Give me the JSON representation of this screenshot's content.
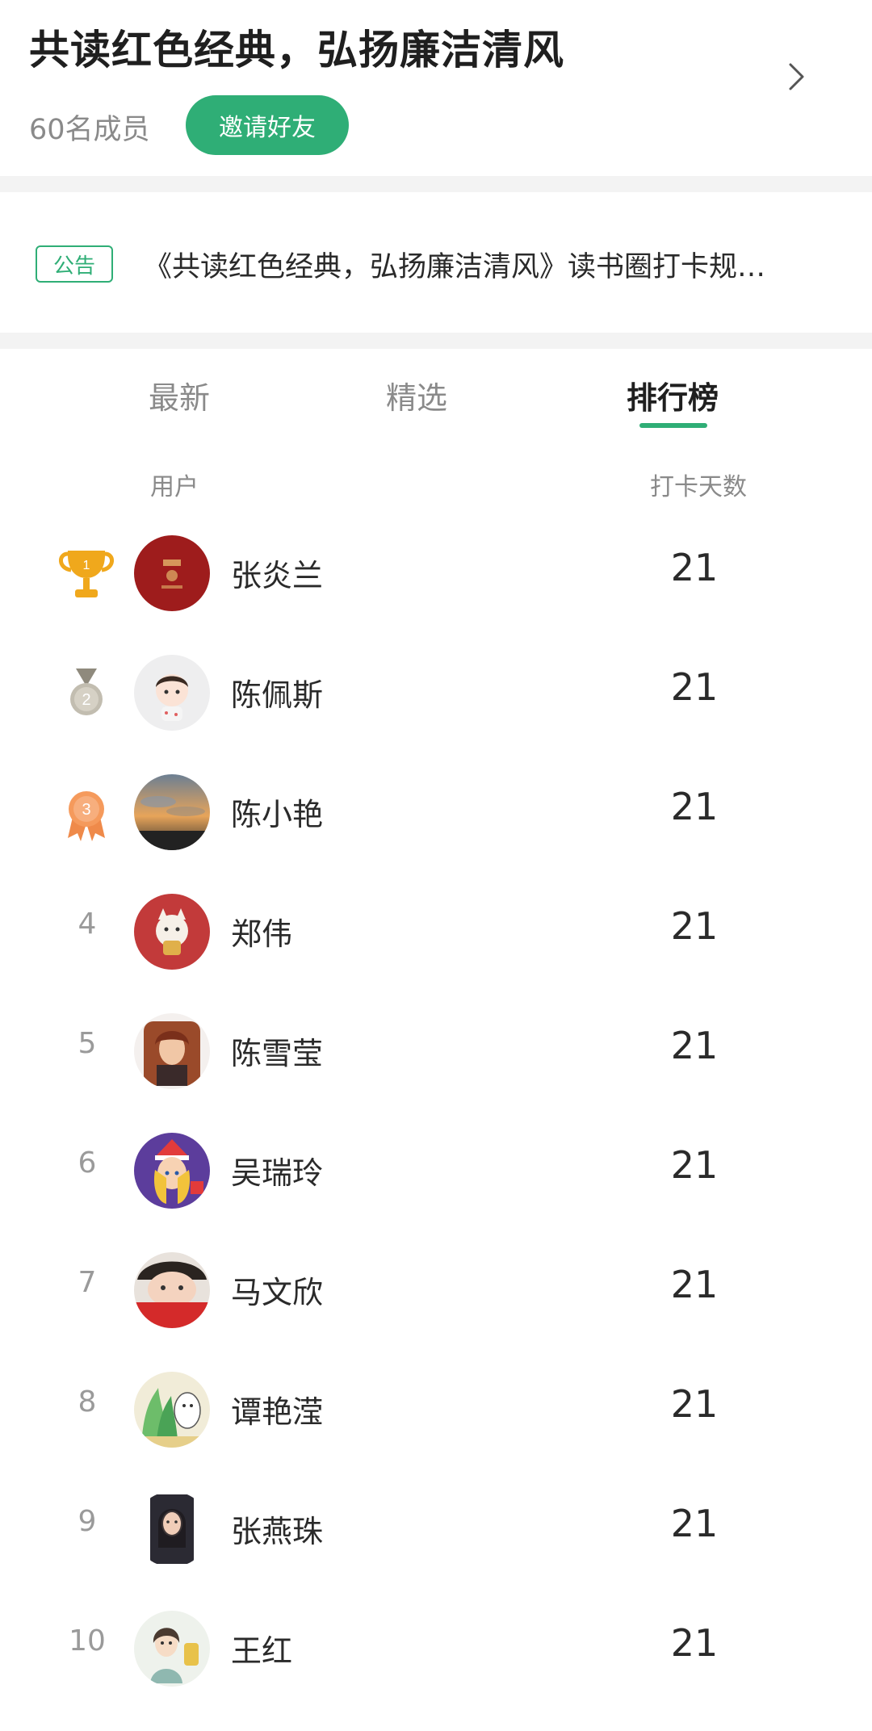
{
  "circle": {
    "title": "共读红色经典，弘扬廉洁清风",
    "member_count": "60名成员",
    "invite_label": "邀请好友"
  },
  "notice": {
    "tag": "公告",
    "text": "《共读红色经典，弘扬廉洁清风》读书圈打卡规…"
  },
  "tabs": [
    {
      "label": "最新",
      "active": false
    },
    {
      "label": "精选",
      "active": false
    },
    {
      "label": "排行榜",
      "active": true
    }
  ],
  "ranking": {
    "col_user": "用户",
    "col_days": "打卡天数",
    "rows": [
      {
        "rank": "1",
        "name": "张炎兰",
        "days": "21",
        "badge": "gold-trophy-icon"
      },
      {
        "rank": "2",
        "name": "陈佩斯",
        "days": "21",
        "badge": "silver-medal-icon"
      },
      {
        "rank": "3",
        "name": "陈小艳",
        "days": "21",
        "badge": "bronze-medal-icon"
      },
      {
        "rank": "4",
        "name": "郑伟",
        "days": "21"
      },
      {
        "rank": "5",
        "name": "陈雪莹",
        "days": "21"
      },
      {
        "rank": "6",
        "name": "吴瑞玲",
        "days": "21"
      },
      {
        "rank": "7",
        "name": "马文欣",
        "days": "21"
      },
      {
        "rank": "8",
        "name": "谭艳滢",
        "days": "21"
      },
      {
        "rank": "9",
        "name": "张燕珠",
        "days": "21"
      },
      {
        "rank": "10",
        "name": "王红",
        "days": "21"
      }
    ]
  },
  "colors": {
    "accent": "#2fae76",
    "gold": "#e9a21c",
    "silver": "#b5b0a2",
    "bronze": "#ef8a4a"
  }
}
